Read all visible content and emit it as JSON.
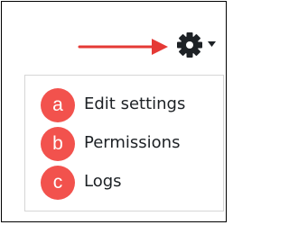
{
  "colors": {
    "annotation_red": "#f2524d",
    "arrow_red": "#e53935",
    "icon_dark": "#1d2125",
    "menu_border": "#d6d6d6"
  },
  "actions": {
    "toggle_icon": "gear-icon",
    "caret_icon": "caret-down-icon"
  },
  "menu": {
    "items": [
      {
        "marker": "a",
        "label": "Edit settings"
      },
      {
        "marker": "b",
        "label": "Permissions"
      },
      {
        "marker": "c",
        "label": "Logs"
      }
    ]
  }
}
